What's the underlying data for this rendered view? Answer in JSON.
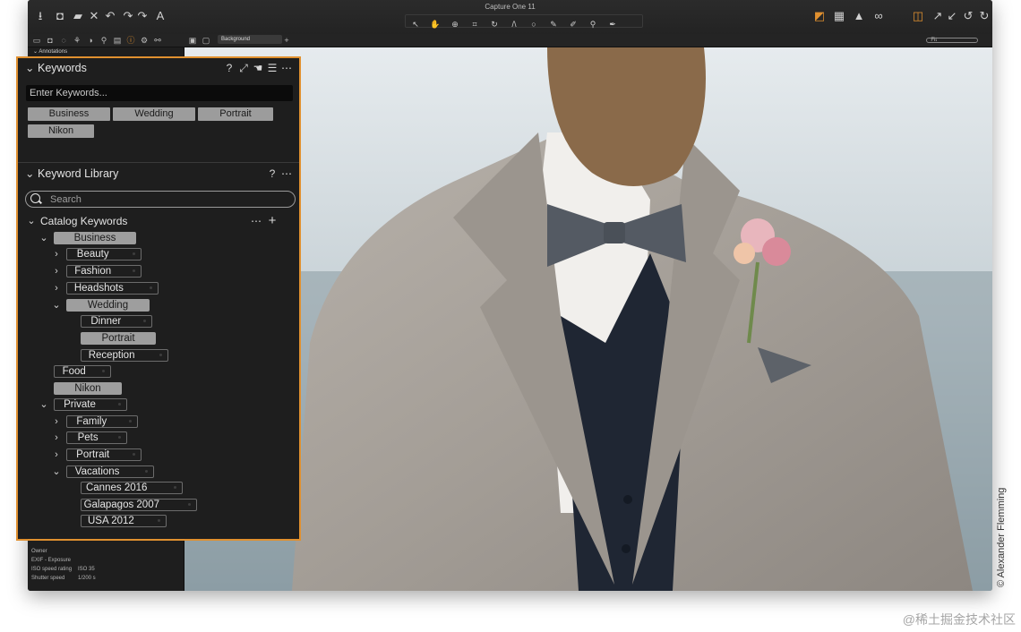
{
  "window": {
    "title": "Capture One 11"
  },
  "subbar": {
    "background_select": "Background",
    "fit_label": "Fit"
  },
  "left_panel": {
    "annotations_label": "Annotations",
    "metadata": [
      {
        "label": "Owner",
        "value": ""
      },
      {
        "label": "EXIF - Exposure",
        "value": ""
      },
      {
        "label": "ISO speed rating",
        "value": "ISO 35"
      },
      {
        "label": "Shutter speed",
        "value": "1/200 s"
      }
    ]
  },
  "keywords_panel": {
    "title": "Keywords",
    "input_placeholder": "Enter Keywords...",
    "chips": [
      "Business",
      "Wedding",
      "Portrait",
      "Nikon"
    ]
  },
  "keyword_library": {
    "title": "Keyword Library",
    "search_placeholder": "Search",
    "catalog_label": "Catalog Keywords",
    "tree": [
      "Business",
      "Beauty",
      "Fashion",
      "Headshots",
      "Wedding",
      "Dinner",
      "Portrait",
      "Reception",
      "Food",
      "Nikon",
      "Private",
      "Family",
      "Pets",
      "Portrait",
      "Vacations",
      "Cannes 2016",
      "Galapagos 2007",
      "USA 2012"
    ]
  },
  "photo_credit": "© Alexander Flemming",
  "attribution": "@稀土掘金技术社区",
  "colors": {
    "accent": "#e0902f",
    "panel_bg": "#1e1e1e",
    "chip_bg": "#9c9c9c"
  },
  "icons": [
    "import-icon",
    "camera-icon",
    "folder-icon",
    "delete-icon",
    "undo-icon",
    "redo-icon",
    "text-icon",
    "help-icon",
    "expand-icon",
    "menu-icon",
    "more-icon",
    "add-icon",
    "search-icon",
    "chevron-down-icon",
    "chevron-right-icon",
    "exposure-warning-icon",
    "grid-icon",
    "alert-icon",
    "glasses-icon",
    "rotate-left-icon",
    "rotate-right-icon"
  ]
}
